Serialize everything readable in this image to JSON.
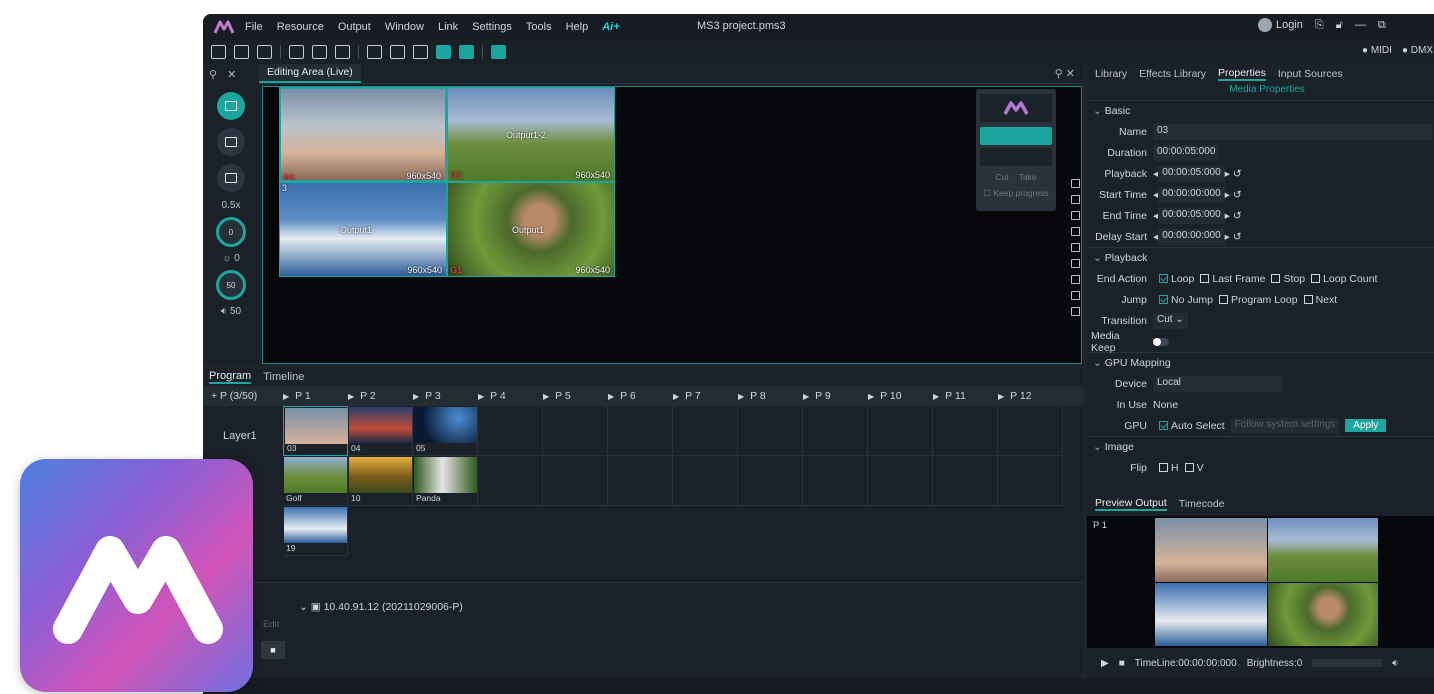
{
  "titlebar": {
    "menu": [
      "File",
      "Resource",
      "Output",
      "Window",
      "Link",
      "Settings",
      "Tools",
      "Help"
    ],
    "ai_label": "Ai+",
    "document": "MS3 project.pms3",
    "login": "Login"
  },
  "status": {
    "items": [
      "MIDI",
      "DMX"
    ]
  },
  "left_rail": {
    "zoom": "0.5x",
    "knob1": "0",
    "val1": "0",
    "knob2": "50",
    "val2": "50"
  },
  "edit": {
    "tab": "Editing Area (Live)",
    "thumbs": [
      {
        "label": "3",
        "res": "960x540",
        "tag": "G1"
      },
      {
        "label": "Output1-2",
        "res": "960x540",
        "tag": "G1"
      },
      {
        "label": "Output1",
        "res": "960x540",
        "tag": "G1"
      },
      {
        "label": "Output1",
        "res": "960x540",
        "tag": "G1"
      }
    ],
    "mini": {
      "cut": "Cut",
      "take": "Take",
      "keep": "Keep progress"
    }
  },
  "program": {
    "tabs": [
      "Program",
      "Timeline"
    ],
    "count": "+ P (3/50)",
    "pages": [
      "P 1",
      "P 2",
      "P 3",
      "P 4",
      "P 5",
      "P 6",
      "P 7",
      "P 8",
      "P 9",
      "P 10",
      "P 11",
      "P 12"
    ],
    "layer": "Layer1",
    "cells": [
      {
        "cap": "03"
      },
      {
        "cap": "04"
      },
      {
        "cap": "05"
      },
      {
        "cap": "Golf"
      },
      {
        "cap": "10"
      },
      {
        "cap": "Panda"
      },
      {
        "cap": "19"
      }
    ]
  },
  "bottom": {
    "node": "10.40.91.12 (20211029006-P)",
    "edit": "Edit"
  },
  "right": {
    "tabs": [
      "Library",
      "Effects Library",
      "Properties",
      "Input Sources"
    ],
    "subtitle": "Media Properties",
    "basic": "Basic",
    "name_k": "Name",
    "name_v": "03",
    "dur_k": "Duration",
    "dur_v": "00:00:05:000",
    "pb_k": "Playback",
    "pb_v": "00:00:05:000",
    "st_k": "Start Time",
    "st_v": "00:00:00:000",
    "et_k": "End Time",
    "et_v": "00:00:05:000",
    "ds_k": "Delay Start",
    "ds_v": "00:00:00:000",
    "playback": "Playback",
    "end_k": "End Action",
    "end_opts": [
      "Loop",
      "Last Frame",
      "Stop",
      "Loop Count"
    ],
    "jump_k": "Jump",
    "jump_opts": [
      "No Jump",
      "Program Loop",
      "Next"
    ],
    "trans_k": "Transition",
    "trans_v": "Cut",
    "keep_k": "Media Keep",
    "gpu": "GPU Mapping",
    "dev_k": "Device",
    "dev_v": "Local",
    "inuse_k": "In Use",
    "inuse_v": "None",
    "gpu_k": "GPU",
    "gpu_auto": "Auto Select",
    "gpu_follow": "Follow system settings",
    "apply": "Apply",
    "image": "Image",
    "flip_k": "Flip",
    "flip_h": "H",
    "flip_v": "V"
  },
  "preview": {
    "tabs": [
      "Preview Output",
      "Timecode"
    ],
    "page": "P 1",
    "timeline": "TimeLine:00:00:00:000",
    "brightness": "Brightness:0"
  }
}
